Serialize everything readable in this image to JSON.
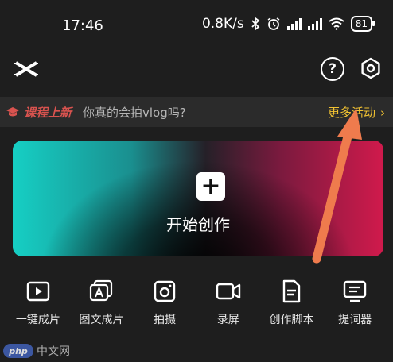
{
  "status_bar": {
    "time": "17:46",
    "network_speed": "0.8K/s",
    "battery": "81",
    "icons": [
      "bluetooth-icon",
      "alarm-icon",
      "hd-signal-icon",
      "hd-signal-icon",
      "wifi-icon",
      "battery-icon"
    ]
  },
  "header": {
    "logo": "capcut-logo",
    "icons": [
      "help-icon",
      "settings-icon"
    ],
    "help_glyph": "?"
  },
  "banner": {
    "tag": "课程上新",
    "message": "你真的会拍vlog吗?",
    "more_link": "更多活动",
    "more_chevron": "›"
  },
  "create": {
    "label": "开始创作",
    "plus": "+",
    "gradient_colors": [
      "#16cfc4",
      "#252028",
      "#d01a4c"
    ]
  },
  "tools": [
    {
      "label": "一键成片",
      "icon": "play-box-icon"
    },
    {
      "label": "图文成片",
      "icon": "stacked-a-icon"
    },
    {
      "label": "拍摄",
      "icon": "camera-icon"
    },
    {
      "label": "录屏",
      "icon": "video-record-icon"
    },
    {
      "label": "创作脚本",
      "icon": "document-icon"
    },
    {
      "label": "提词器",
      "icon": "teleprompter-icon"
    }
  ],
  "watermark": {
    "badge": "php",
    "text": "中文网"
  },
  "annotation": {
    "arrow_color": "#ef7b4d"
  },
  "colors": {
    "background": "#1e1e1e",
    "banner_bg": "#2b2b2b",
    "tag_red": "#d9534f",
    "more_yellow": "#f1c232"
  }
}
